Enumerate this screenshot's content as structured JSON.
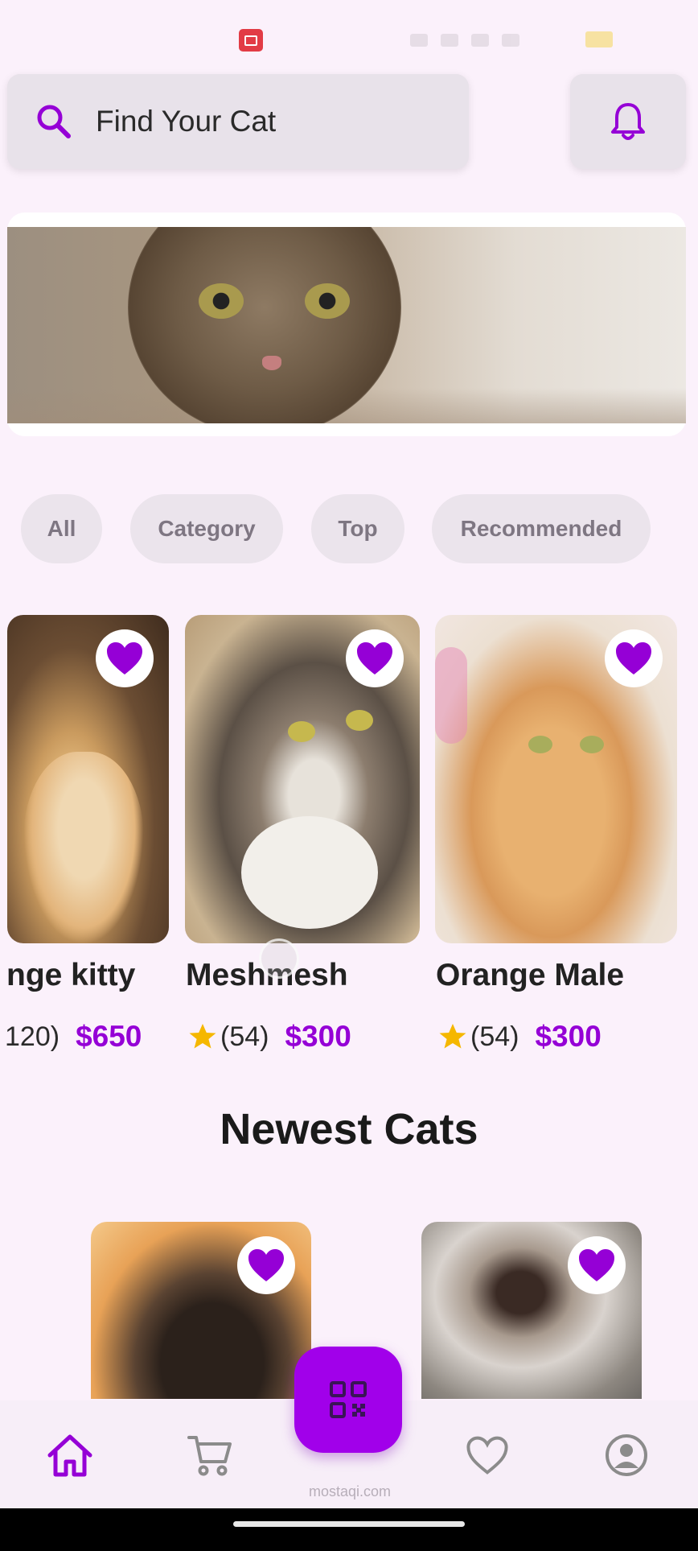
{
  "search": {
    "placeholder": "Find Your Cat"
  },
  "filters": [
    "All",
    "Category",
    "Top",
    "Recommended"
  ],
  "cats": [
    {
      "name": "nge kitty",
      "rating_count": "120)",
      "price": "$650",
      "show_star": false
    },
    {
      "name": "Meshmesh",
      "rating_count": "(54)",
      "price": "$300",
      "show_star": true
    },
    {
      "name": "Orange Male",
      "rating_count": "(54)",
      "price": "$300",
      "show_star": true
    }
  ],
  "section": {
    "newest_title": "Newest Cats"
  },
  "watermark": "mostaqi.com",
  "icons": {
    "search": "search-icon",
    "notifications": "bell-icon",
    "favorite": "heart-icon",
    "rating": "star-icon",
    "home": "home-icon",
    "cart": "cart-icon",
    "scan": "qr-code-icon",
    "favorites_nav": "heart-outline-icon",
    "profile": "user-circle-icon"
  },
  "colors": {
    "accent": "#9500d6",
    "fab": "#a100ea",
    "background": "#fbf1fb",
    "star": "#f5b700"
  }
}
